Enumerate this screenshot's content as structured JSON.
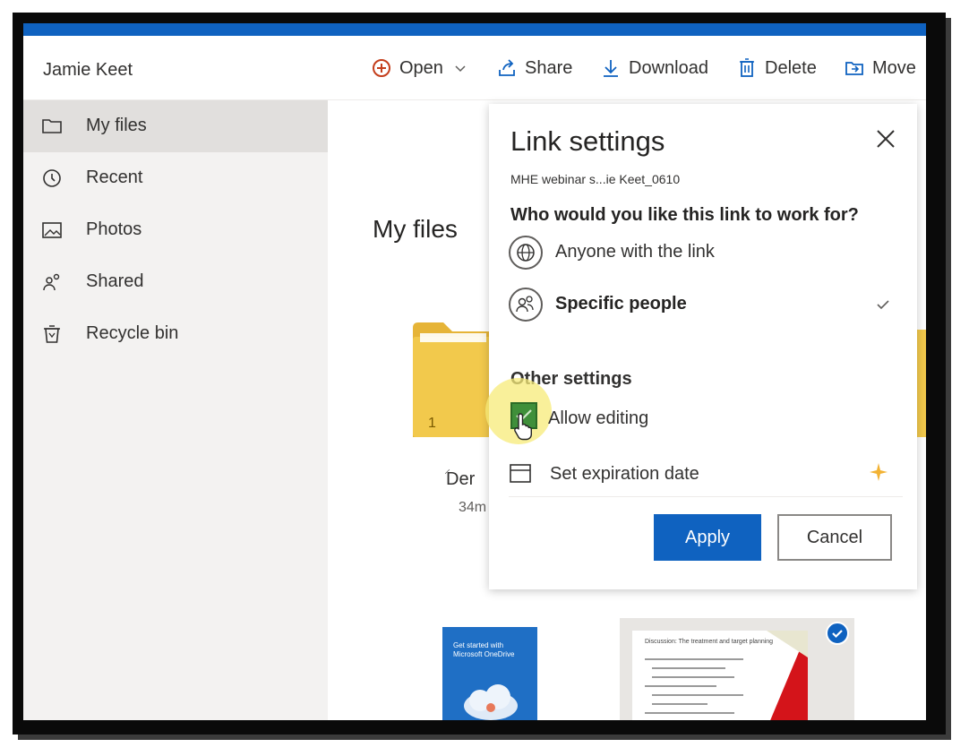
{
  "colors": {
    "accent": "#0f62c0",
    "checkbox": "#3f8f3a",
    "folder": "#f2c94c",
    "premium": "#f2b233"
  },
  "commandbar": {
    "user_name": "Jamie Keet",
    "open_label": "Open",
    "share_label": "Share",
    "download_label": "Download",
    "delete_label": "Delete",
    "move_label": "Move"
  },
  "sidebar": {
    "items": [
      {
        "label": "My files",
        "icon": "folder-icon",
        "active": true
      },
      {
        "label": "Recent",
        "icon": "clock-icon"
      },
      {
        "label": "Photos",
        "icon": "photo-icon"
      },
      {
        "label": "Shared",
        "icon": "people-icon"
      },
      {
        "label": "Recycle bin",
        "icon": "trash-icon"
      }
    ]
  },
  "main": {
    "title": "My files",
    "folder_count": "1",
    "file_name": "Der",
    "file_time": "34m",
    "share_glyph": "⸝",
    "thumb1_text": "Get started with Microsoft OneDrive",
    "thumb2_text": "Discussion: The treatment and target planning"
  },
  "link_settings": {
    "title": "Link settings",
    "subtitle": "MHE webinar s...ie Keet_0610",
    "question": "Who would you like this link to work for?",
    "options": [
      {
        "label": "Anyone with the link",
        "icon": "globe-icon",
        "selected": false
      },
      {
        "label": "Specific people",
        "icon": "people-icon",
        "selected": true
      }
    ],
    "other_settings": "Other settings",
    "allow_editing": "Allow editing",
    "allow_editing_checked": true,
    "expiration_label": "Set expiration date",
    "apply_label": "Apply",
    "cancel_label": "Cancel"
  }
}
